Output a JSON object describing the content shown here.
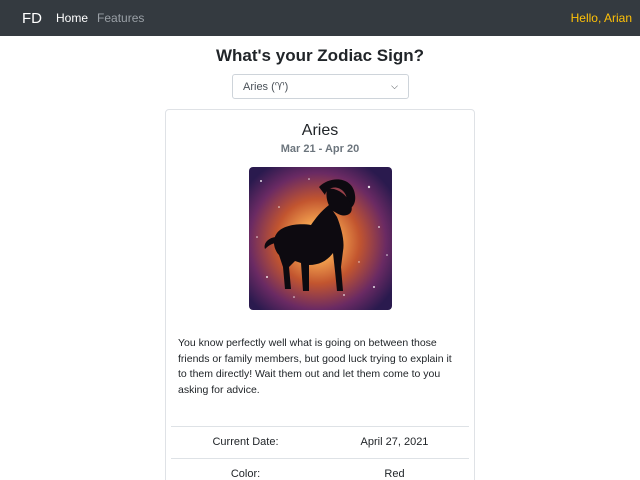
{
  "navbar": {
    "brand": "FD",
    "links": [
      {
        "label": "Home",
        "active": true
      },
      {
        "label": "Features",
        "active": false
      }
    ],
    "greeting": "Hello, Arian"
  },
  "main": {
    "heading": "What's your Zodiac Sign?",
    "select": {
      "selected": "Aries (♈)"
    }
  },
  "card": {
    "title": "Aries",
    "dates": "Mar 21 - Apr 20",
    "image_icon": "ram-silhouette-on-nebula",
    "description": "You know perfectly well what is going on between those friends or family members, but good luck trying to explain it to them directly! Wait them out and let them come to you asking for advice.",
    "rows": [
      {
        "label": "Current Date:",
        "value": "April 27, 2021"
      },
      {
        "label": "Color:",
        "value": "Red"
      }
    ]
  },
  "colors": {
    "navbar_bg": "#343a40",
    "greeting": "#ffc107"
  }
}
